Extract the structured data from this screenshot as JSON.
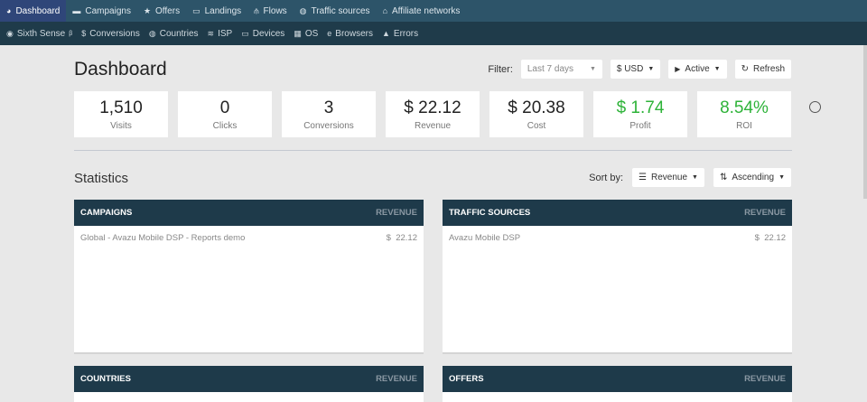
{
  "nav_primary": [
    {
      "icon": "dashboard-icon",
      "glyph": "◕",
      "label": "Dashboard",
      "active": true
    },
    {
      "icon": "briefcase-icon",
      "glyph": "▬",
      "label": "Campaigns"
    },
    {
      "icon": "star-icon",
      "glyph": "★",
      "label": "Offers"
    },
    {
      "icon": "window-icon",
      "glyph": "▭",
      "label": "Landings"
    },
    {
      "icon": "sitemap-icon",
      "glyph": "⫛",
      "label": "Flows"
    },
    {
      "icon": "globe-icon",
      "glyph": "◍",
      "label": "Traffic sources"
    },
    {
      "icon": "bank-icon",
      "glyph": "⌂",
      "label": "Affiliate networks"
    }
  ],
  "nav_secondary": [
    {
      "icon": "eye-icon",
      "glyph": "◉",
      "label": "Sixth Sense",
      "sup": "β"
    },
    {
      "icon": "dollar-icon",
      "glyph": "$",
      "label": "Conversions"
    },
    {
      "icon": "globe-icon",
      "glyph": "◍",
      "label": "Countries"
    },
    {
      "icon": "wifi-icon",
      "glyph": "≋",
      "label": "ISP"
    },
    {
      "icon": "laptop-icon",
      "glyph": "▭",
      "label": "Devices"
    },
    {
      "icon": "windows-icon",
      "glyph": "▦",
      "label": "OS"
    },
    {
      "icon": "ie-icon",
      "glyph": "e",
      "label": "Browsers"
    },
    {
      "icon": "warning-icon",
      "glyph": "▲",
      "label": "Errors"
    }
  ],
  "page": {
    "title": "Dashboard",
    "filter_label": "Filter:",
    "date_range": "Last 7 days",
    "currency": "$ USD",
    "status": "Active",
    "refresh": "Refresh"
  },
  "cards": [
    {
      "value": "1,510",
      "label": "Visits"
    },
    {
      "value": "0",
      "label": "Clicks"
    },
    {
      "value": "3",
      "label": "Conversions"
    },
    {
      "value": "$ 22.12",
      "label": "Revenue"
    },
    {
      "value": "$ 20.38",
      "label": "Cost"
    },
    {
      "value": "$ 1.74",
      "label": "Profit",
      "color": "#2eb339"
    },
    {
      "value": "8.54%",
      "label": "ROI",
      "color": "#2eb339"
    }
  ],
  "statistics": {
    "title": "Statistics",
    "sort_label": "Sort by:",
    "sort_field": "Revenue",
    "sort_order": "Ascending"
  },
  "panels": [
    {
      "title": "CAMPAIGNS",
      "col": "REVENUE",
      "rows": [
        {
          "name": "Global - Avazu Mobile DSP - Reports demo",
          "value": "$  22.12"
        }
      ]
    },
    {
      "title": "TRAFFIC SOURCES",
      "col": "REVENUE",
      "rows": [
        {
          "name": "Avazu Mobile DSP",
          "value": "$  22.12"
        }
      ]
    },
    {
      "title": "COUNTRIES",
      "col": "REVENUE",
      "rows": []
    },
    {
      "title": "OFFERS",
      "col": "REVENUE",
      "rows": []
    }
  ]
}
